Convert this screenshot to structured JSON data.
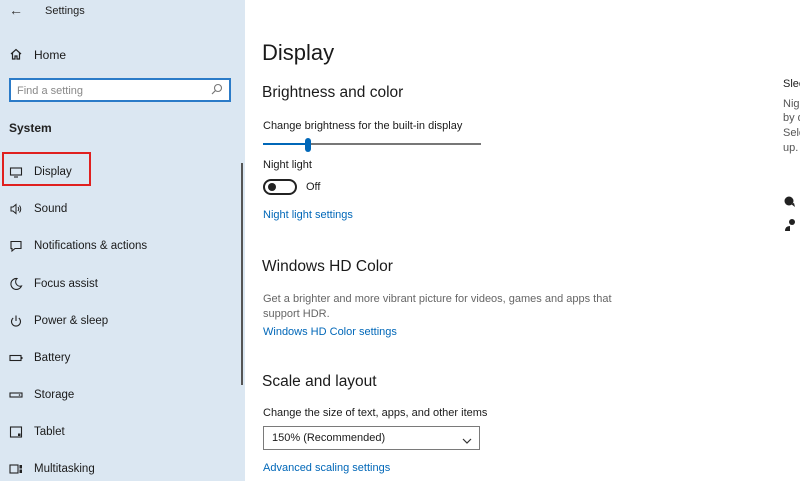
{
  "window": {
    "back_glyph": "←",
    "title": "Settings"
  },
  "sidebar": {
    "home_label": "Home",
    "search_placeholder": "Find a setting",
    "section_title": "System",
    "items": [
      {
        "label": "Display",
        "icon": "monitor-icon",
        "selected": true
      },
      {
        "label": "Sound",
        "icon": "speaker-icon"
      },
      {
        "label": "Notifications & actions",
        "icon": "notification-icon"
      },
      {
        "label": "Focus assist",
        "icon": "moon-icon"
      },
      {
        "label": "Power & sleep",
        "icon": "power-icon"
      },
      {
        "label": "Battery",
        "icon": "battery-icon"
      },
      {
        "label": "Storage",
        "icon": "storage-icon"
      },
      {
        "label": "Tablet",
        "icon": "tablet-icon"
      },
      {
        "label": "Multitasking",
        "icon": "multitasking-icon"
      }
    ]
  },
  "main": {
    "title": "Display",
    "brightness": {
      "heading": "Brightness and color",
      "slider_label": "Change brightness for the built-in display",
      "slider_value": 0.2,
      "night_light_label": "Night light",
      "night_light_state": "Off",
      "night_light_link": "Night light settings"
    },
    "hdr": {
      "heading": "Windows HD Color",
      "description_line1": "Get a brighter and more vibrant picture for videos, games and apps that",
      "description_line2": "support HDR.",
      "link": "Windows HD Color settings"
    },
    "scale": {
      "heading": "Scale and layout",
      "label": "Change the size of text, apps, and other items",
      "selected": "150% (Recommended)",
      "link": "Advanced scaling settings"
    }
  },
  "related_panel": {
    "heading_fragment": "Slee",
    "lines": [
      "Nigl",
      "by d",
      "Sele",
      "up."
    ]
  },
  "colors": {
    "accent": "#0067b8",
    "sidebar_bg": "#dbe7f2",
    "selection_outline": "#e0201f"
  }
}
